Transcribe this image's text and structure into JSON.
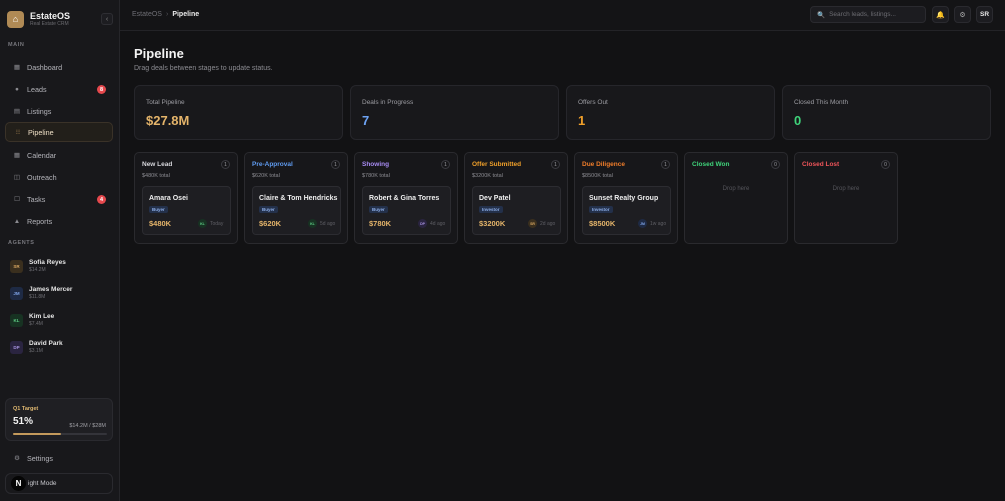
{
  "brand": {
    "name": "EstateOS",
    "sub": "Real Estate CRM",
    "logo_icon": "house-icon",
    "collapse_icon": "chevron-left-icon"
  },
  "sidebar": {
    "main_label": "MAIN",
    "items": [
      {
        "label": "Dashboard",
        "icon": "grid-icon",
        "glyph": "▦",
        "badge": ""
      },
      {
        "label": "Leads",
        "icon": "circle-icon",
        "glyph": "●",
        "badge": "8"
      },
      {
        "label": "Listings",
        "icon": "building-icon",
        "glyph": "▤",
        "badge": ""
      },
      {
        "label": "Pipeline",
        "icon": "columns-icon",
        "glyph": "⁝⁝",
        "badge": ""
      },
      {
        "label": "Calendar",
        "icon": "calendar-icon",
        "glyph": "▦",
        "badge": ""
      },
      {
        "label": "Outreach",
        "icon": "mail-icon",
        "glyph": "◫",
        "badge": ""
      },
      {
        "label": "Tasks",
        "icon": "checkbox-icon",
        "glyph": "☐",
        "badge": "4"
      },
      {
        "label": "Reports",
        "icon": "chart-icon",
        "glyph": "▲",
        "badge": ""
      }
    ],
    "agents_label": "AGENTS",
    "agents": [
      {
        "initials": "SR",
        "name": "Sofia Reyes",
        "value": "$14.2M",
        "bg": "#3a2f1e",
        "fg": "#d9a862"
      },
      {
        "initials": "JM",
        "name": "James Mercer",
        "value": "$11.8M",
        "bg": "#1e2a44",
        "fg": "#7ea3e6"
      },
      {
        "initials": "KL",
        "name": "Kim Lee",
        "value": "$7.4M",
        "bg": "#173222",
        "fg": "#5fcf86"
      },
      {
        "initials": "DP",
        "name": "David Park",
        "value": "$3.1M",
        "bg": "#2a2440",
        "fg": "#a793e0"
      }
    ],
    "target": {
      "label": "Q1 Target",
      "percent_text": "51%",
      "progress": 0.51,
      "amount": "$14.2M / $28M"
    },
    "settings_label": "Settings",
    "settings_icon": "gear-icon",
    "mode_label": "ight Mode",
    "mode_icon": "N"
  },
  "topbar": {
    "breadcrumb_root": "EstateOS",
    "breadcrumb_sep": "›",
    "breadcrumb_current": "Pipeline",
    "search_placeholder": "Search leads, listings...",
    "search_icon": "search-icon",
    "bell_icon": "bell-icon",
    "settings_icon": "gear-icon",
    "user_initials": "SR"
  },
  "page": {
    "title": "Pipeline",
    "subtitle": "Drag deals between stages to update status."
  },
  "stats": [
    {
      "label": "Total Pipeline",
      "value": "$27.8M",
      "color": "#e4b46a"
    },
    {
      "label": "Deals in Progress",
      "value": "7",
      "color": "#6ea4f5"
    },
    {
      "label": "Offers Out",
      "value": "1",
      "color": "#f0a02a"
    },
    {
      "label": "Closed This Month",
      "value": "0",
      "color": "#3fd37a"
    }
  ],
  "columns": [
    {
      "title": "New Lead",
      "color": "#d7d7dc",
      "total": "$480K total",
      "count": "1",
      "deal": {
        "name": "Amara Osei",
        "tag": "Buyer",
        "value": "$480K",
        "avatar": "KL",
        "avatar_bg": "#173222",
        "avatar_fg": "#5fcf86",
        "time": "Today"
      }
    },
    {
      "title": "Pre-Approval",
      "color": "#5f9bf0",
      "total": "$620K total",
      "count": "1",
      "deal": {
        "name": "Claire & Tom Hendricks",
        "tag": "Buyer",
        "value": "$620K",
        "avatar": "KL",
        "avatar_bg": "#173222",
        "avatar_fg": "#5fcf86",
        "time": "5d ago"
      }
    },
    {
      "title": "Showing",
      "color": "#a78bf2",
      "total": "$780K total",
      "count": "1",
      "deal": {
        "name": "Robert & Gina Torres",
        "tag": "Buyer",
        "value": "$780K",
        "avatar": "DP",
        "avatar_bg": "#2a2440",
        "avatar_fg": "#a793e0",
        "time": "4d ago"
      }
    },
    {
      "title": "Offer Submitted",
      "color": "#f0a02a",
      "total": "$3200K total",
      "count": "1",
      "deal": {
        "name": "Dev Patel",
        "tag": "Investor",
        "value": "$3200K",
        "avatar": "SR",
        "avatar_bg": "#3a2f1e",
        "avatar_fg": "#d9a862",
        "time": "2d ago"
      }
    },
    {
      "title": "Due Diligence",
      "color": "#f07d2a",
      "total": "$8500K total",
      "count": "1",
      "deal": {
        "name": "Sunset Realty Group",
        "tag": "Investor",
        "value": "$8500K",
        "avatar": "JM",
        "avatar_bg": "#1e2a44",
        "avatar_fg": "#7ea3e6",
        "time": "1w ago"
      }
    },
    {
      "title": "Closed Won",
      "color": "#3fd37a",
      "total": "",
      "count": "0",
      "drop": "Drop here"
    },
    {
      "title": "Closed Lost",
      "color": "#f0555a",
      "total": "",
      "count": "0",
      "drop": "Drop here"
    }
  ]
}
